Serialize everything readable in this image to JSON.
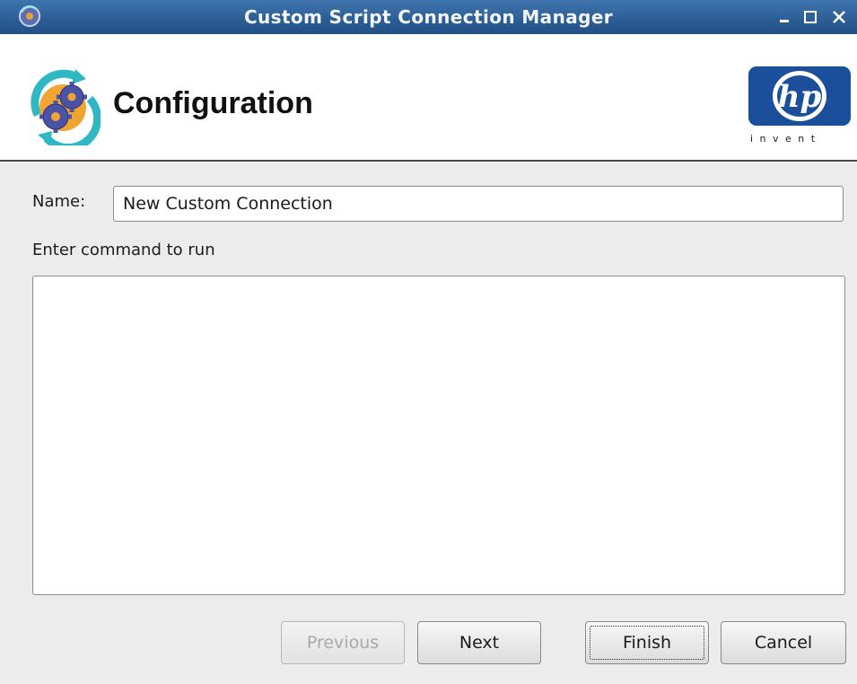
{
  "window": {
    "title": "Custom Script Connection Manager",
    "controls": {
      "minimize": "minimize",
      "maximize": "maximize",
      "close": "close"
    }
  },
  "header": {
    "title": "Configuration",
    "logo_text": "hp",
    "logo_tagline": "invent"
  },
  "form": {
    "name_label": "Name:",
    "name_value": "New Custom Connection",
    "command_label": "Enter command to run",
    "command_value": ""
  },
  "buttons": {
    "previous": "Previous",
    "next": "Next",
    "finish": "Finish",
    "cancel": "Cancel"
  },
  "colors": {
    "titlebar": "#2a5c93",
    "hp_blue": "#1b4f9b",
    "window_bg": "#ececec"
  },
  "icons": [
    "app-gear-icon",
    "minimize-icon",
    "maximize-icon",
    "close-icon",
    "configuration-gears-icon",
    "hp-logo-icon"
  ]
}
